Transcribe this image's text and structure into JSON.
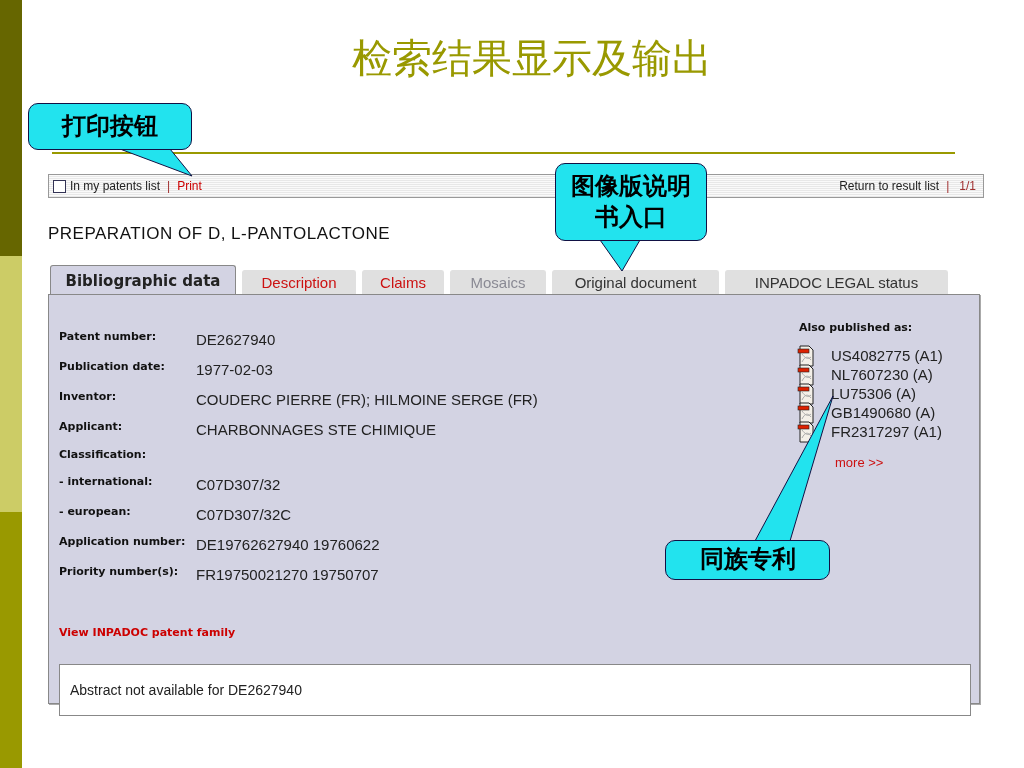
{
  "slide_title": "检索结果显示及输出",
  "toolbar": {
    "checkbox": {
      "label": "In my patents list",
      "checked": false
    },
    "separator_left": "|",
    "print": "Print",
    "return": "Return to result list",
    "separator_right": "|",
    "pages": "1/1"
  },
  "heading": "PREPARATION OF D, L-PANTOLACTONE",
  "tabs": [
    {
      "label": "Bibliographic data",
      "selected": true,
      "disabled": false,
      "kind": "plain"
    },
    {
      "label": "Description",
      "selected": false,
      "disabled": false,
      "kind": "highlighted"
    },
    {
      "label": "Claims",
      "selected": false,
      "disabled": false,
      "kind": "highlighted"
    },
    {
      "label": "Mosaics",
      "selected": false,
      "disabled": true,
      "kind": "plain"
    },
    {
      "label": "Original document",
      "selected": false,
      "disabled": false,
      "kind": "plain"
    },
    {
      "label": "INPADOC LEGAL status",
      "selected": false,
      "disabled": false,
      "kind": "plain"
    }
  ],
  "fields": [
    {
      "label": "Patent number:",
      "value": "DE2627940"
    },
    {
      "label": "Publication date:",
      "value": "1977-02-03"
    },
    {
      "label": "Inventor:",
      "value": "COUDERC PIERRE (FR); HILMOINE SERGE (FR)"
    },
    {
      "label": "Applicant:",
      "value": "CHARBONNAGES STE CHIMIQUE"
    },
    {
      "label": "Classification:"
    },
    {
      "label": "- international:",
      "value": "C07D307/32"
    },
    {
      "label": "- european:",
      "value": "C07D307/32C"
    },
    {
      "label": "Application number:",
      "value": "DE19762627940 19760622"
    },
    {
      "label": "Priority number(s):",
      "value": "FR19750021270 19750707"
    }
  ],
  "also_published": {
    "heading": "Also published as:",
    "items": [
      "US4082775 (A1)",
      "NL7607230 (A)",
      "LU75306 (A)",
      "GB1490680 (A)",
      "FR2317297 (A1)"
    ],
    "more": "more >>"
  },
  "family_link": "View INPADOC patent family",
  "abstract": "Abstract not available for DE2627940",
  "callouts": [
    {
      "text": "打印按钮"
    },
    {
      "text": "图像版说明书入口"
    },
    {
      "text": "同族专利"
    }
  ]
}
